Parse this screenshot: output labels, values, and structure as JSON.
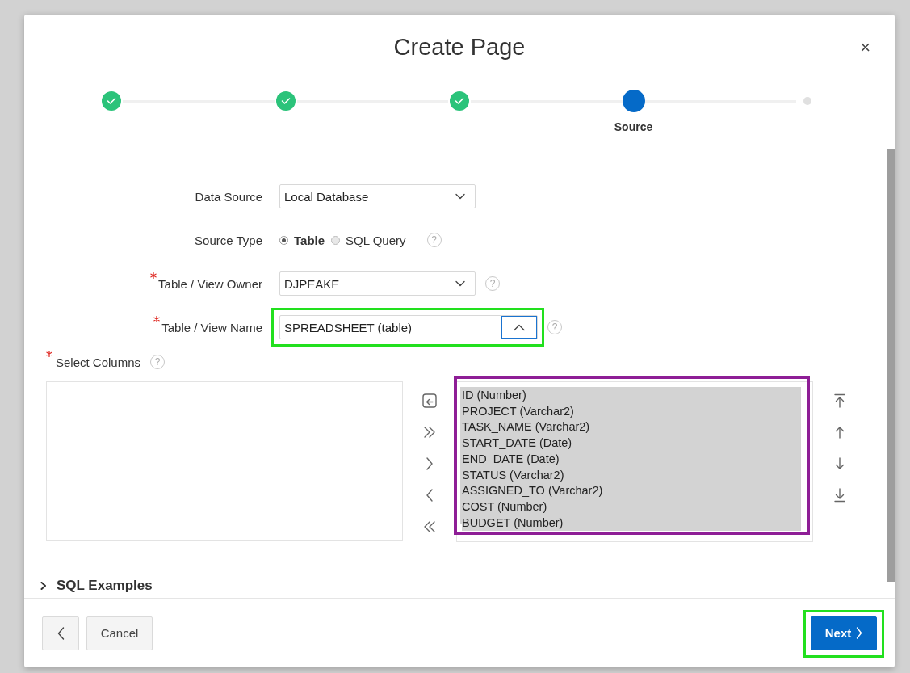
{
  "dialog": {
    "title": "Create Page",
    "close": "×"
  },
  "steps": [
    {
      "completed": true,
      "current": false
    },
    {
      "completed": true,
      "current": false
    },
    {
      "completed": true,
      "current": false
    },
    {
      "completed": false,
      "current": true,
      "label": "Source"
    },
    {
      "completed": false,
      "current": false
    }
  ],
  "fields": [
    {
      "kind": "select",
      "label": "Data Source",
      "required": false,
      "value": "Local Database",
      "expanded": false,
      "highlighted": false
    },
    {
      "kind": "radio",
      "label": "Source Type",
      "required": false,
      "help": "?",
      "options": [
        {
          "label": "Table",
          "selected": true
        },
        {
          "label": "SQL Query",
          "selected": false
        }
      ]
    },
    {
      "kind": "select",
      "label": "Table / View Owner",
      "required": true,
      "help": "?",
      "value": "DJPEAKE",
      "expanded": false,
      "highlighted": false
    },
    {
      "kind": "select",
      "label": "Table / View Name",
      "required": true,
      "help": "?",
      "value": "SPREADSHEET (table)",
      "expanded": true,
      "highlighted": true
    }
  ],
  "columns": {
    "label": "Select Columns",
    "required": true,
    "help": "?",
    "selected_list_highlighted": true,
    "selected_list": [
      {
        "label": "ID (Number)",
        "selected": true
      },
      {
        "label": "PROJECT (Varchar2)",
        "selected": true
      },
      {
        "label": "TASK_NAME (Varchar2)",
        "selected": true
      },
      {
        "label": "START_DATE (Date)",
        "selected": true
      },
      {
        "label": "END_DATE (Date)",
        "selected": true
      },
      {
        "label": "STATUS (Varchar2)",
        "selected": true
      },
      {
        "label": "ASSIGNED_TO (Varchar2)",
        "selected": true
      },
      {
        "label": "COST (Number)",
        "selected": true
      },
      {
        "label": "BUDGET (Number)",
        "selected": true
      }
    ]
  },
  "sql_examples": {
    "label": "SQL Examples",
    "expanded": false
  },
  "footer": {
    "cancel": "Cancel",
    "next": "Next",
    "next_highlighted": true
  }
}
